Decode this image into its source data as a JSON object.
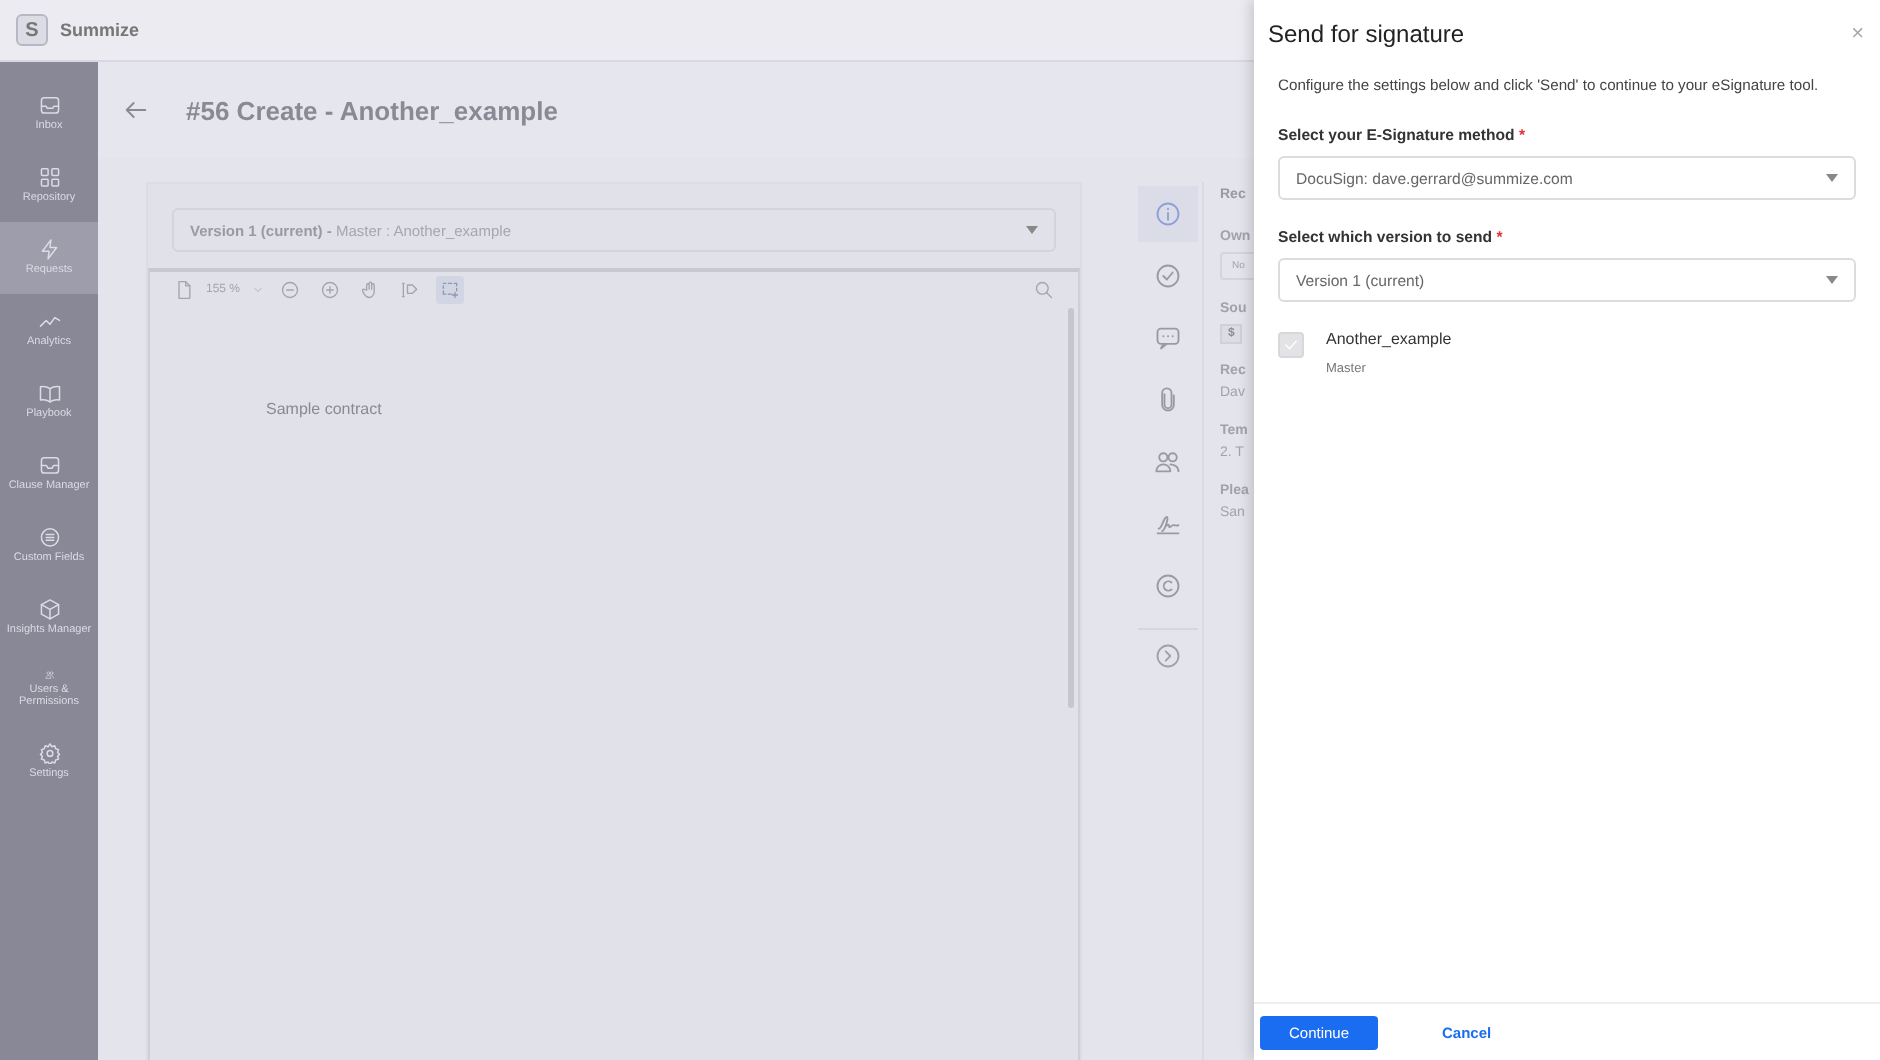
{
  "app": {
    "logo": "S",
    "name": "Summize"
  },
  "sidebar": {
    "items": [
      {
        "label": "Inbox",
        "selected": false
      },
      {
        "label": "Repository",
        "selected": false
      },
      {
        "label": "Requests",
        "selected": true
      },
      {
        "label": "Analytics",
        "selected": false
      },
      {
        "label": "Playbook",
        "selected": false
      },
      {
        "label": "Clause Manager",
        "selected": false
      },
      {
        "label": "Custom Fields",
        "selected": false
      },
      {
        "label": "Insights Manager",
        "selected": false
      },
      {
        "label": "Users & Permissions",
        "selected": false
      },
      {
        "label": "Settings",
        "selected": false
      }
    ]
  },
  "page": {
    "title": "#56 Create - Another_example",
    "version_select": "**Version 1 (current) -** Master : Another_example",
    "viewer": {
      "zoom": "155 %",
      "tools": [
        {
          "selected": false
        },
        {
          "selected": false
        },
        {
          "selected": false
        },
        {
          "selected": false
        },
        {
          "selected": true
        }
      ],
      "document_text": "Sample contract"
    },
    "side_tabs": [
      {
        "selected": true
      },
      {
        "selected": false
      },
      {
        "selected": false
      },
      {
        "selected": false
      },
      {
        "selected": false
      },
      {
        "selected": false
      },
      {
        "selected": false
      }
    ],
    "details": {
      "heading": "Rec",
      "fields": [
        {
          "kind": "select",
          "label": "Own",
          "value": "No"
        },
        {
          "kind": "logo",
          "label": "Sou",
          "value": "$"
        },
        {
          "kind": "text",
          "label": "Rec",
          "value": "Dav"
        },
        {
          "kind": "text",
          "label": "Tem",
          "value": "2. T"
        },
        {
          "kind": "text",
          "label": "Plea",
          "value": "San"
        }
      ]
    }
  },
  "dialog": {
    "title": "Send for signature",
    "close": "×",
    "description": "Configure the settings below and click 'Send' to continue to your eSignature tool.",
    "fields": [
      {
        "label": "Select your E-Signature method",
        "required_mark": "*",
        "value": "DocuSign: dave.gerrard@summize.com"
      },
      {
        "label": "Select which version to send",
        "required_mark": "*",
        "value": "Version 1 (current)"
      }
    ],
    "documents": [
      {
        "name": "Another_example",
        "subtitle": "Master",
        "checked": true,
        "disabled": true
      }
    ],
    "buttons": [
      {
        "kind": "primary",
        "label": "Continue"
      },
      {
        "kind": "link",
        "label": "Cancel"
      }
    ]
  }
}
